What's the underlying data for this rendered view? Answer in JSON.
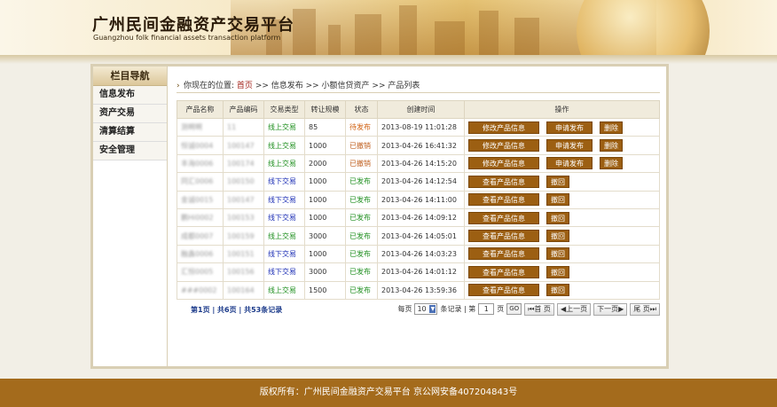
{
  "header": {
    "title": "广州民间金融资产交易平台",
    "subtitle": "Guangzhou folk financial assets transaction platform"
  },
  "sidebar": {
    "title": "栏目导航",
    "items": [
      "信息发布",
      "资产交易",
      "清算结算",
      "安全管理"
    ]
  },
  "breadcrumb": {
    "prefix": "你现在的位置:",
    "home": "首页",
    "path": ">> 信息发布 >> 小额信贷资产 >> 产品列表"
  },
  "table": {
    "headers": [
      "产品名称",
      "产品编码",
      "交易类型",
      "转让规模",
      "状态",
      "创建时间",
      "操作"
    ],
    "rows": [
      {
        "name": "测啊啊",
        "code": "11",
        "type": "线上交易",
        "type_class": "online",
        "scale": "85",
        "status": "待发布",
        "status_class": "s-pending",
        "time": "2013-08-19 11:01:28",
        "a1": "修改产品信息",
        "a2": "申请发布",
        "a3": "删除"
      },
      {
        "name": "恒诚0004",
        "code": "100147",
        "type": "线上交易",
        "type_class": "online",
        "scale": "1000",
        "status": "已撤销",
        "status_class": "s-rev",
        "time": "2013-04-26 16:41:32",
        "a1": "修改产品信息",
        "a2": "申请发布",
        "a3": "删除"
      },
      {
        "name": "丰海0006",
        "code": "100174",
        "type": "线上交易",
        "type_class": "online",
        "scale": "2000",
        "status": "已撤销",
        "status_class": "s-rev",
        "time": "2013-04-26 14:15:20",
        "a1": "修改产品信息",
        "a2": "申请发布",
        "a3": "删除"
      },
      {
        "name": "同汇0006",
        "code": "100150",
        "type": "线下交易",
        "type_class": "offline",
        "scale": "1000",
        "status": "已发布",
        "status_class": "s-pub",
        "time": "2013-04-26 14:12:54",
        "a1": "查看产品信息",
        "a2": "撤回",
        "a3": ""
      },
      {
        "name": "金诚0015",
        "code": "100147",
        "type": "线下交易",
        "type_class": "offline",
        "scale": "1000",
        "status": "已发布",
        "status_class": "s-pub",
        "time": "2013-04-26 14:11:00",
        "a1": "查看产品信息",
        "a2": "撤回",
        "a3": ""
      },
      {
        "name": "鹏Hi0002",
        "code": "100153",
        "type": "线下交易",
        "type_class": "offline",
        "scale": "1000",
        "status": "已发布",
        "status_class": "s-pub",
        "time": "2013-04-26 14:09:12",
        "a1": "查看产品信息",
        "a2": "撤回",
        "a3": ""
      },
      {
        "name": "成都0007",
        "code": "100159",
        "type": "线上交易",
        "type_class": "online",
        "scale": "3000",
        "status": "已发布",
        "status_class": "s-pub",
        "time": "2013-04-26 14:05:01",
        "a1": "查看产品信息",
        "a2": "撤回",
        "a3": ""
      },
      {
        "name": "融鑫0006",
        "code": "100151",
        "type": "线下交易",
        "type_class": "offline",
        "scale": "1000",
        "status": "已发布",
        "status_class": "s-pub",
        "time": "2013-04-26 14:03:23",
        "a1": "查看产品信息",
        "a2": "撤回",
        "a3": ""
      },
      {
        "name": "汇恒0005",
        "code": "100156",
        "type": "线下交易",
        "type_class": "offline",
        "scale": "3000",
        "status": "已发布",
        "status_class": "s-pub",
        "time": "2013-04-26 14:01:12",
        "a1": "查看产品信息",
        "a2": "撤回",
        "a3": ""
      },
      {
        "name": "###0002",
        "code": "100164",
        "type": "线上交易",
        "type_class": "online",
        "scale": "1500",
        "status": "已发布",
        "status_class": "s-pub",
        "time": "2013-04-26 13:59:36",
        "a1": "查看产品信息",
        "a2": "撤回",
        "a3": ""
      }
    ]
  },
  "pager": {
    "summary": "第1页 | 共6页 | 共53条记录",
    "per_page_label": "每页",
    "per_page": "10",
    "records_label": "条记录 | 第",
    "page": "1",
    "page_suffix": "页",
    "go": "GO",
    "first": "首 页",
    "prev": "上一页",
    "next": "下一页",
    "last": "尾 页"
  },
  "footer": {
    "text": "版权所有：广州民间金融资产交易平台 京公网安备407204843号"
  }
}
